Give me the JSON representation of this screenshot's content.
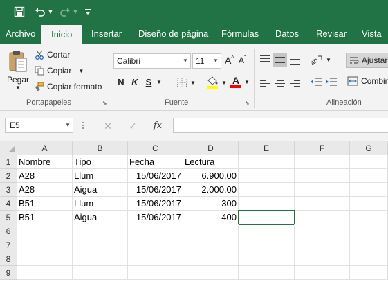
{
  "colors": {
    "accent": "#217346",
    "ribbon": "#f3f3f3",
    "highlight": "#ffff00",
    "font_color": "#ff0000"
  },
  "qat": {
    "icons": [
      "save-icon",
      "undo-icon",
      "redo-icon",
      "customize-icon"
    ]
  },
  "tabs": [
    {
      "label": "Archivo"
    },
    {
      "label": "Inicio",
      "active": true
    },
    {
      "label": "Insertar"
    },
    {
      "label": "Diseño de página"
    },
    {
      "label": "Fórmulas"
    },
    {
      "label": "Datos"
    },
    {
      "label": "Revisar"
    },
    {
      "label": "Vista"
    }
  ],
  "ribbon": {
    "clipboard": {
      "group_label": "Portapapeles",
      "paste_label": "Pegar",
      "cut_label": "Cortar",
      "copy_label": "Copiar",
      "format_painter_label": "Copiar formato"
    },
    "font": {
      "group_label": "Fuente",
      "font_name": "Calibri",
      "font_size": "11",
      "bold": "N",
      "italic": "K",
      "underline": "S",
      "increase_font": "A",
      "decrease_font": "A",
      "font_color_letter": "A"
    },
    "alignment": {
      "group_label": "Alineación",
      "wrap_text_label": "Ajustar",
      "merge_label": "Combin"
    }
  },
  "formula_bar": {
    "name_box": "E5",
    "formula": "",
    "fx": "fx"
  },
  "sheet": {
    "columns": [
      "A",
      "B",
      "C",
      "D",
      "E",
      "F",
      "G"
    ],
    "rows": [
      "1",
      "2",
      "3",
      "4",
      "5",
      "6",
      "7",
      "8",
      "9"
    ],
    "selected_cell": "E5",
    "cells": [
      [
        "Nombre",
        "Tipo",
        "Fecha",
        "Lectura"
      ],
      [
        "A28",
        "Llum",
        "15/06/2017",
        "6.900,00"
      ],
      [
        "A28",
        "Aigua",
        "15/06/2017",
        "2.000,00"
      ],
      [
        "B51",
        "Llum",
        "15/06/2017",
        "300"
      ],
      [
        "B51",
        "Aigua",
        "15/06/2017",
        "400"
      ]
    ]
  }
}
